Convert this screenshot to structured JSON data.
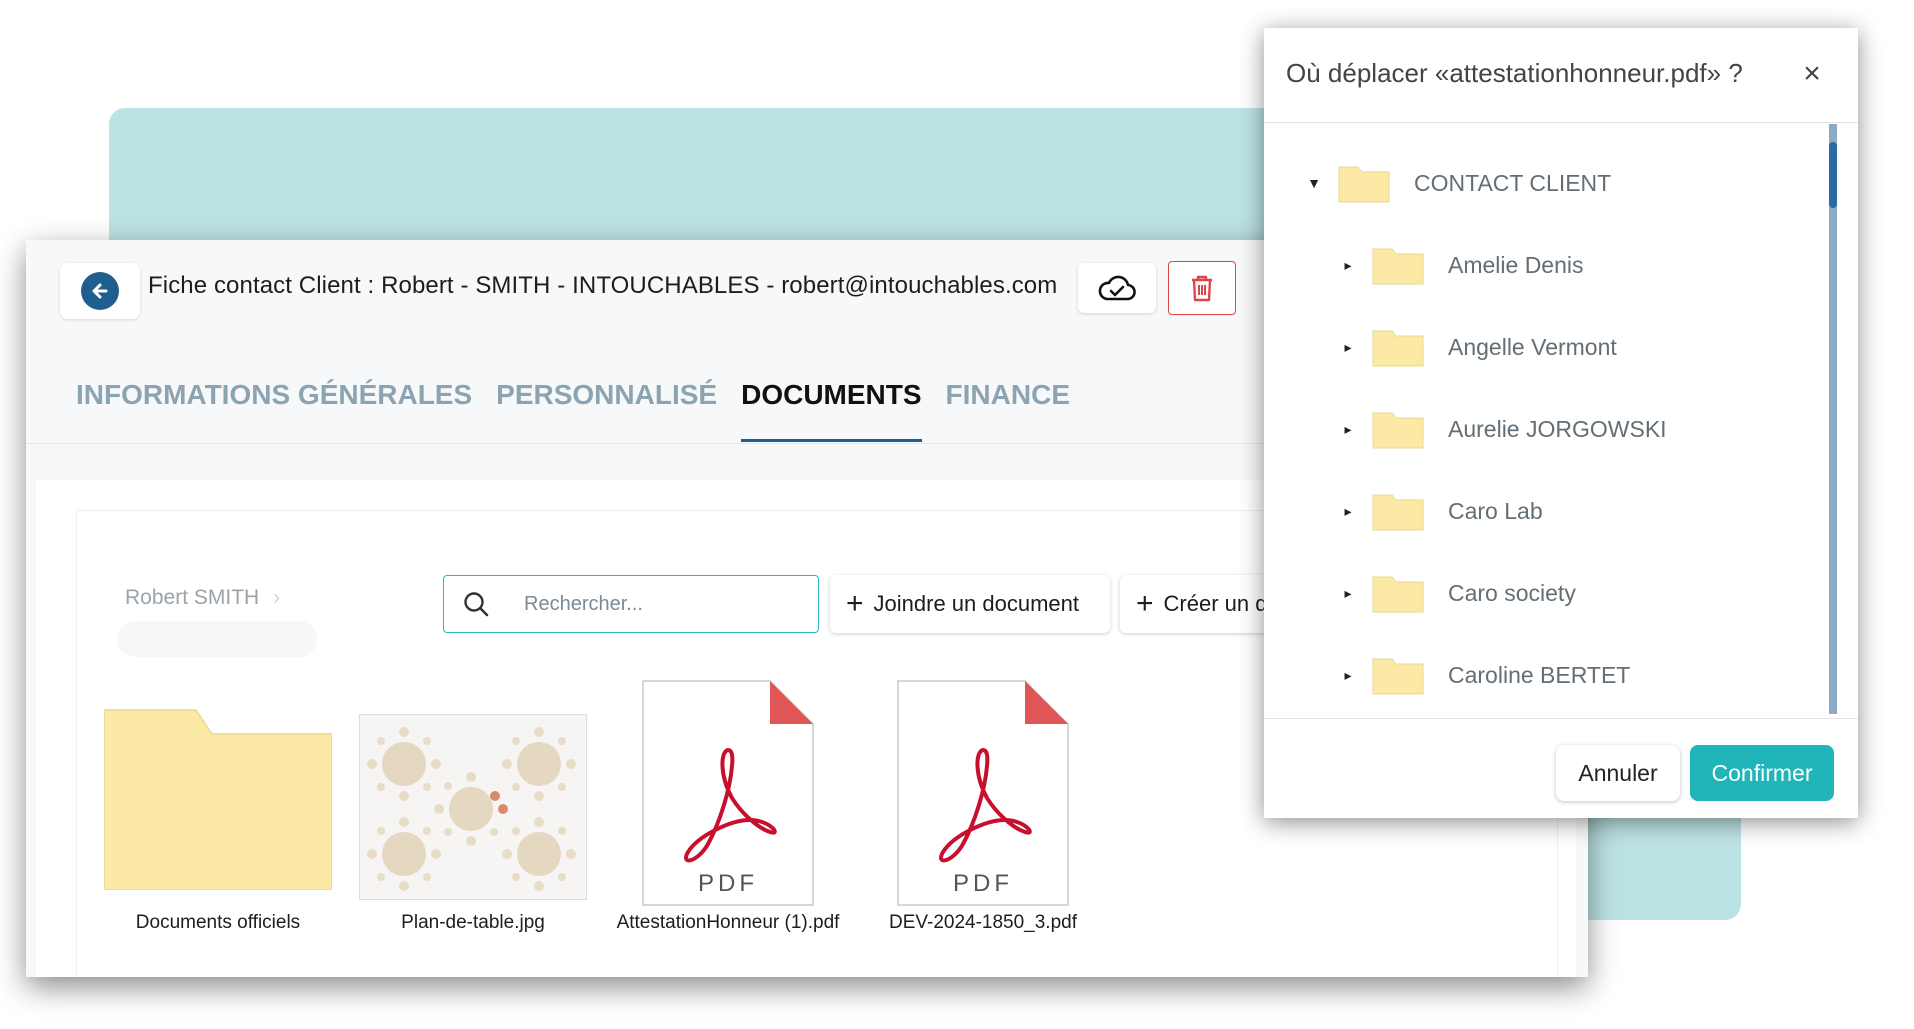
{
  "header": {
    "title": "Fiche contact Client : Robert - SMITH - INTOUCHABLES - robert@intouchables.com"
  },
  "tabs": [
    {
      "label": "INFORMATIONS GÉNÉRALES",
      "active": false
    },
    {
      "label": "PERSONNALISÉ",
      "active": false
    },
    {
      "label": "DOCUMENTS",
      "active": true
    },
    {
      "label": "FINANCE",
      "active": false
    }
  ],
  "breadcrumb": {
    "label": "Robert SMITH"
  },
  "search": {
    "placeholder": "Rechercher...",
    "value": ""
  },
  "actions": {
    "attach_label": "Joindre un document",
    "create_label": "Créer un dossier"
  },
  "files": [
    {
      "name": "Documents officiels",
      "type": "folder"
    },
    {
      "name": "Plan-de-table.jpg",
      "type": "image"
    },
    {
      "name": "AttestationHonneur (1).pdf",
      "type": "pdf"
    },
    {
      "name": "DEV-2024-1850_3.pdf",
      "type": "pdf"
    }
  ],
  "pdf_icon_label": "PDF",
  "dialog": {
    "title": "Où déplacer «attestationhonneur.pdf» ?",
    "root": "CONTACT CLIENT",
    "items": [
      "Amelie Denis",
      "Angelle Vermont",
      "Aurelie JORGOWSKI",
      "Caro Lab",
      "Caro society",
      "Caroline BERTET"
    ],
    "cancel_label": "Annuler",
    "confirm_label": "Confirmer"
  },
  "colors": {
    "accent": "#1fb5b9",
    "primary": "#1f5f8e",
    "danger": "#e04545",
    "folder": "#fce9a6",
    "teal_background": "#bce3e4"
  }
}
